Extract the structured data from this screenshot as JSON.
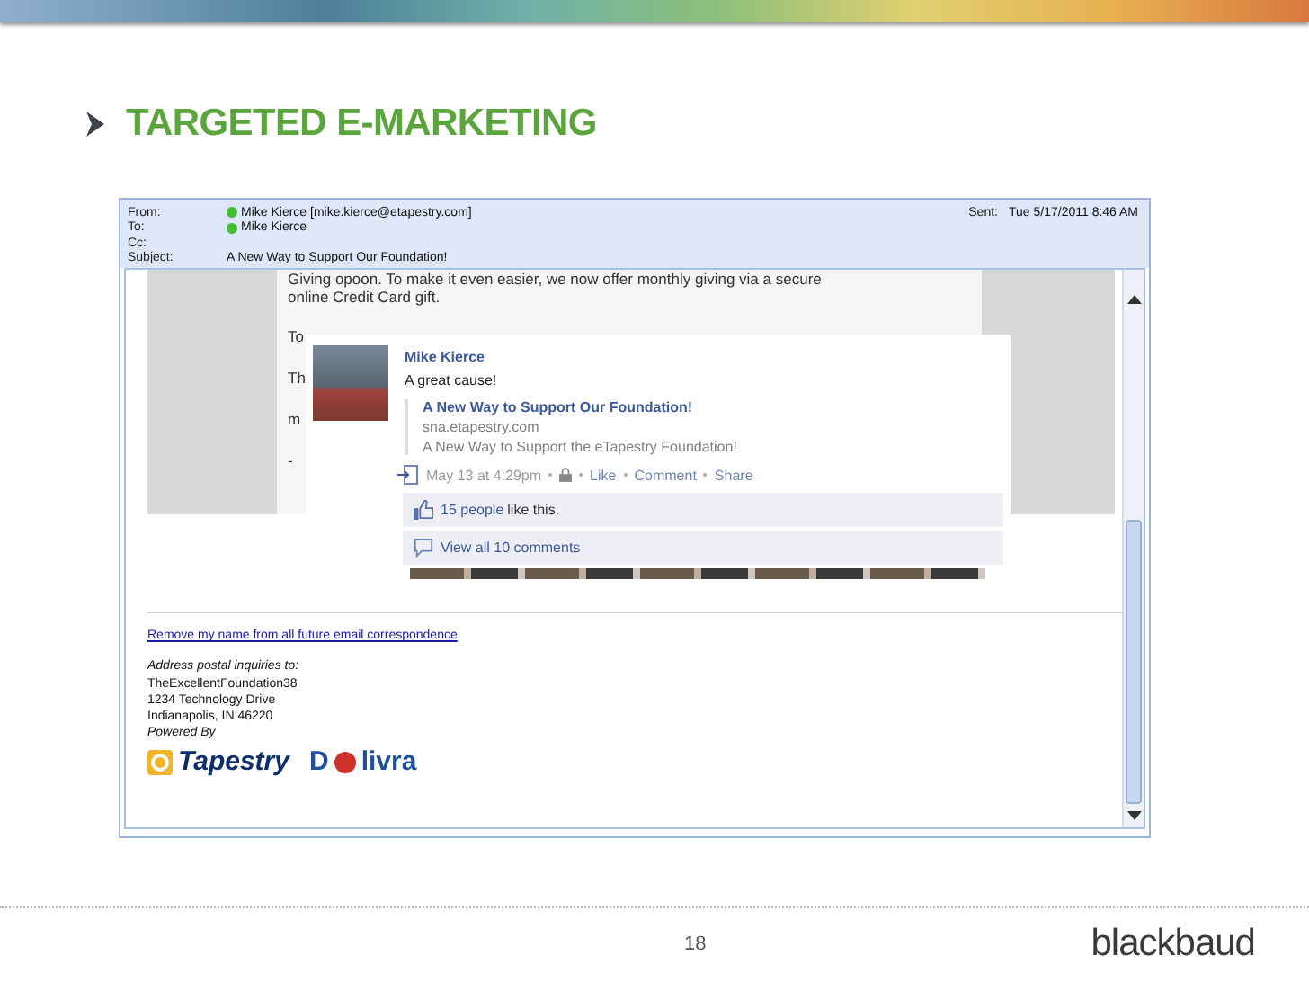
{
  "slide": {
    "title": "TARGETED E-MARKETING",
    "page_number": "18",
    "brand": "blackbaud"
  },
  "email": {
    "header": [
      {
        "label": "From:",
        "value": "Mike Kierce [mike.kierce@etapestry.com]",
        "presence": true
      },
      {
        "label": "To:",
        "value": "Mike Kierce",
        "presence": true
      },
      {
        "label": "Cc:",
        "presence": false
      },
      {
        "label": "Subject:",
        "value": "A New Way to Support Our Foundation!",
        "presence": false
      }
    ],
    "sent_label": "Sent:",
    "sent": "Tue 5/17/2011 8:46 AM",
    "body_lines": [
      "Giving opoon.  To make it even easier, we now offer monthly giving via a secure",
      "online Credit Card gift."
    ],
    "covered_fragments": [
      "To",
      "Th",
      "m",
      "-"
    ],
    "social_post": {
      "name": "Mike Kierce",
      "message": "A great cause!",
      "link_title": "A New Way to Support Our Foundation!",
      "link_domain": "sna.etapestry.com",
      "link_description": "A New Way to Support the eTapestry Foundation!",
      "time": "May 13 at 4:29pm",
      "actions": [
        "Like",
        "Comment",
        "Share"
      ],
      "likes_link": "15 people",
      "likes_text": "like this.",
      "comments_link": "View all 10 comments"
    },
    "footer": {
      "unsubscribe_link": "Remove my name from all future email correspondence",
      "address_intro": "Address postal inquiries to:",
      "address_lines": [
        "TheExcellentFoundation38",
        "1234 Technology Drive",
        "Indianapolis, IN 46220"
      ],
      "powered_by": "Powered By",
      "logo_1": "Tapestry",
      "logo_2_start": "D",
      "logo_2_end": "livra"
    }
  }
}
